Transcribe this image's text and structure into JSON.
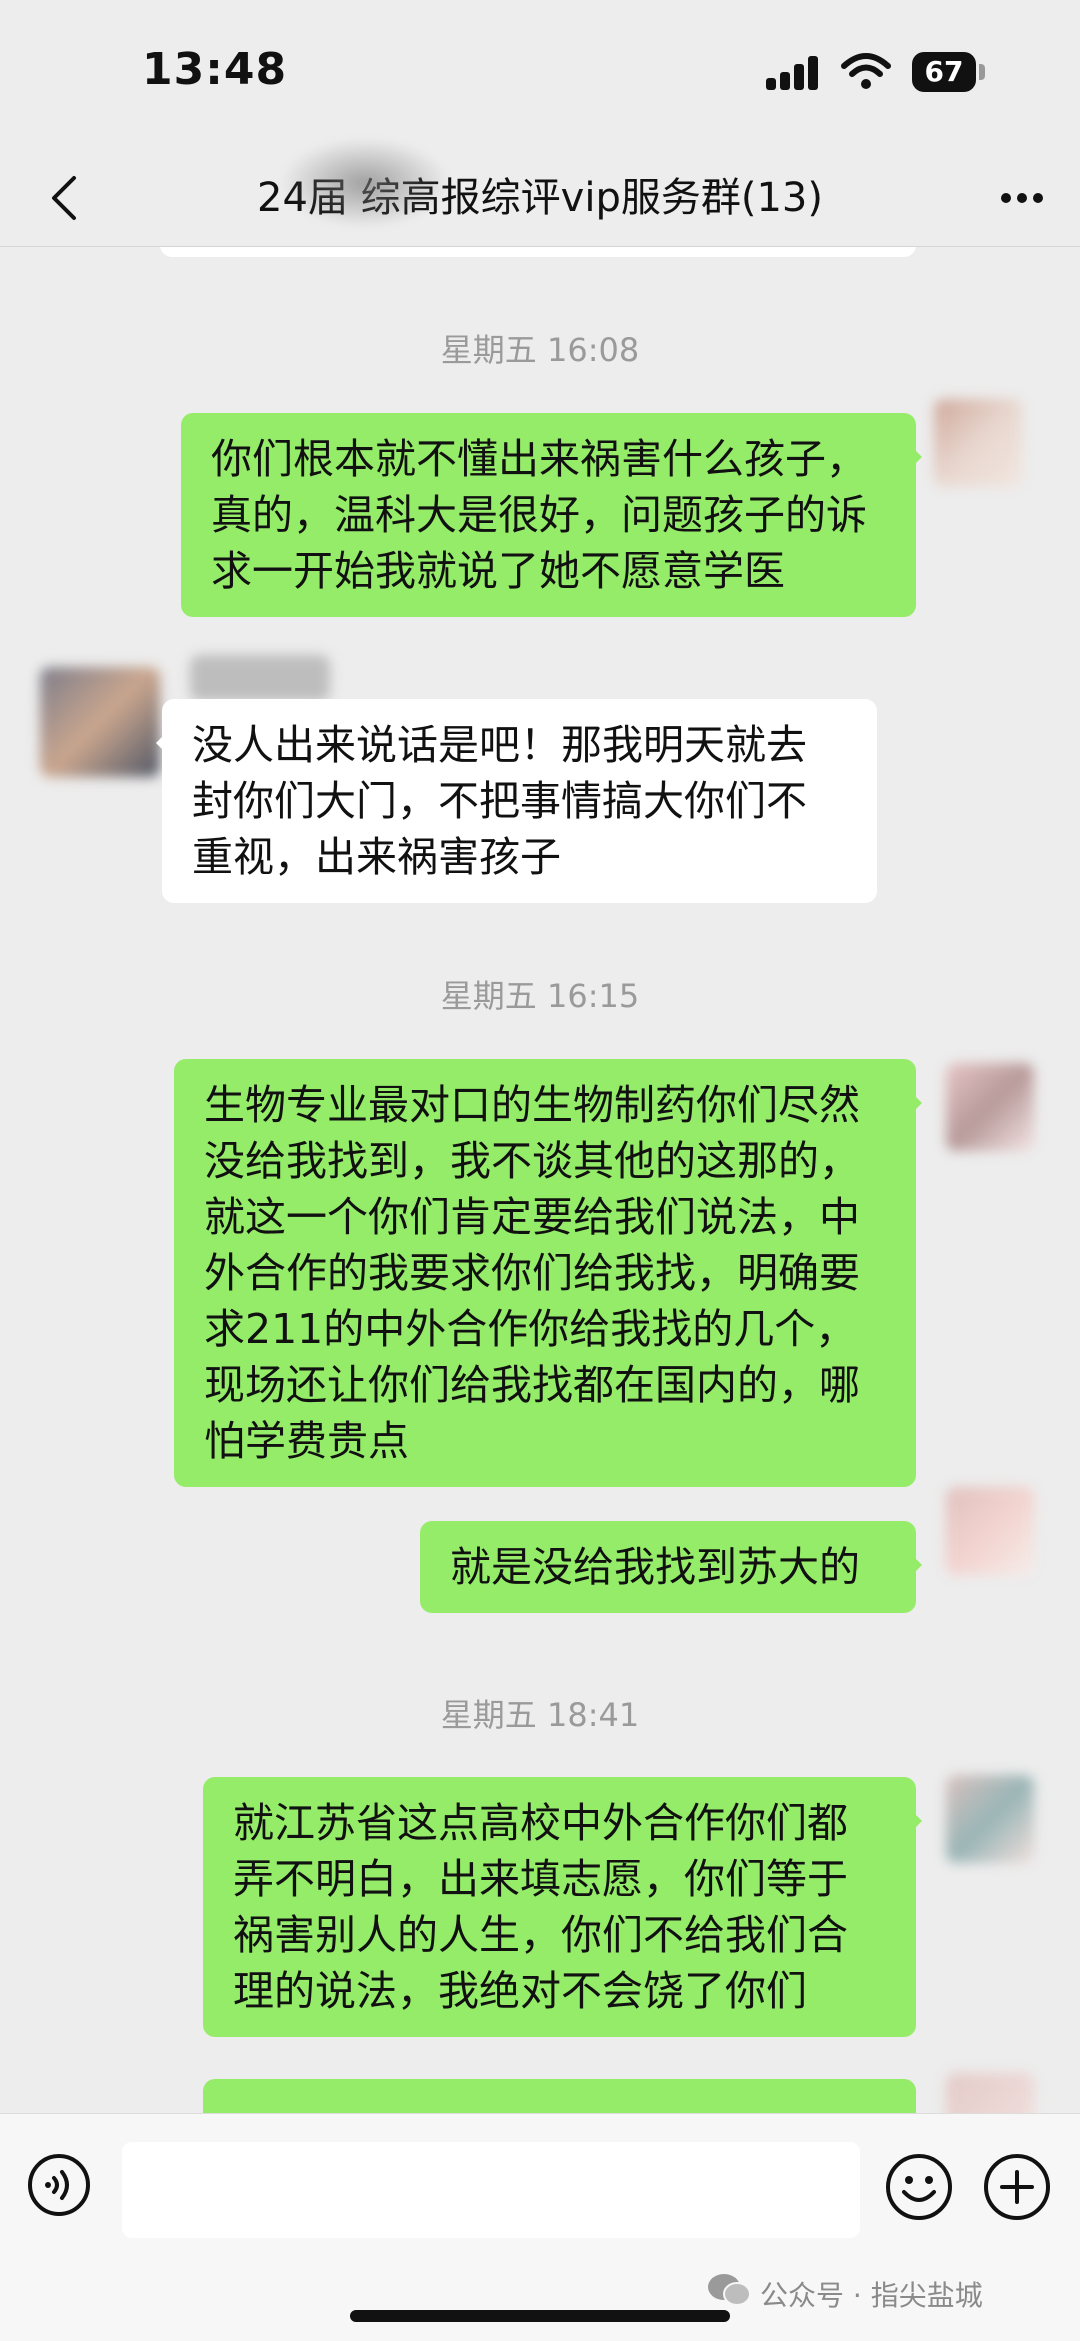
{
  "status": {
    "time": "13:48",
    "battery": "67"
  },
  "header": {
    "title": "24届 综高报综评vip服务群(13)"
  },
  "messages": [
    {
      "timestamp": "星期五 16:08"
    },
    {
      "text": "你们根本就不懂出来祸害什么孩子，真的，温科大是很好，问题孩子的诉求一开始我就说了她不愿意学医"
    },
    {
      "text": "没人出来说话是吧！那我明天就去封你们大门，不把事情搞大你们不重视，出来祸害孩子"
    },
    {
      "timestamp": "星期五 16:15"
    },
    {
      "text": "生物专业最对口的生物制药你们尽然没给我找到，我不谈其他的这那的，就这一个你们肯定要给我们说法，中外合作的我要求你们给我找，明确要求211的中外合作你给我找的几个，现场还让你们给我找都在国内的，哪怕学费贵点"
    },
    {
      "text": "就是没给我找到苏大的"
    },
    {
      "timestamp": "星期五 18:41"
    },
    {
      "text": "就江苏省这点高校中外合作你们都弄不明白，出来填志愿，你们等于祸害别人的人生，你们不给我们合理的说法，我绝对不会饶了你们"
    }
  ],
  "watermark": "公众号 · 指尖盐城",
  "icons": [
    "back-icon",
    "more-icon",
    "voice-icon",
    "emoji-icon",
    "plus-icon",
    "wechat-icon",
    "signal-icon",
    "wifi-icon",
    "battery-icon"
  ]
}
